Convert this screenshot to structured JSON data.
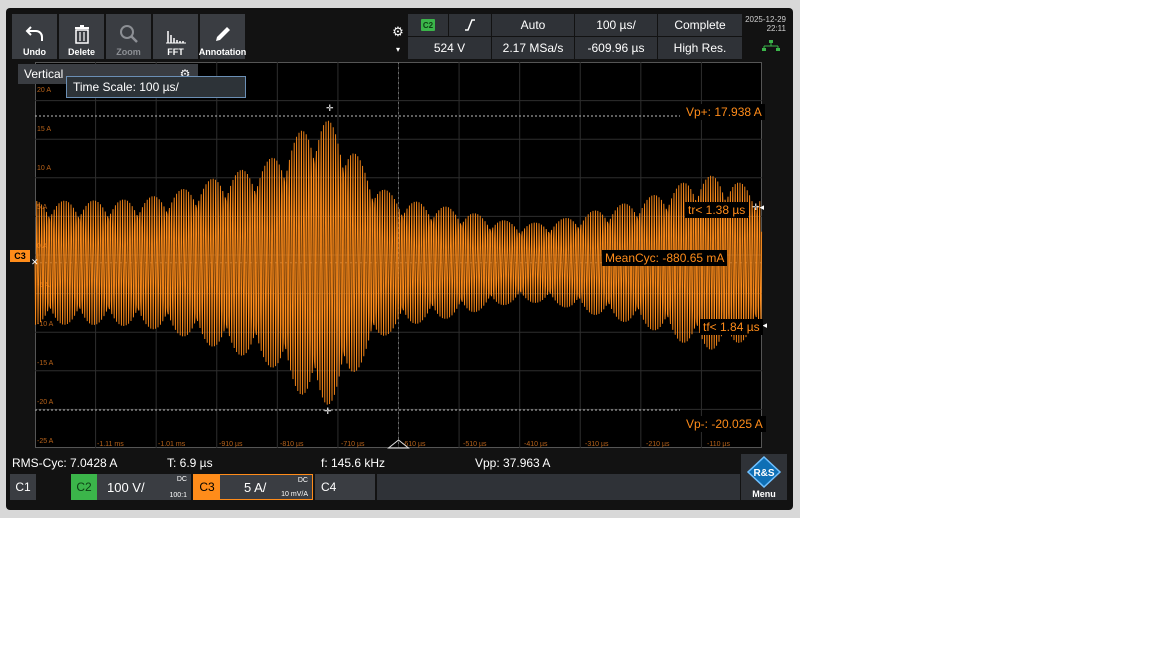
{
  "toolbar": {
    "undo_label": "Undo",
    "delete_label": "Delete",
    "zoom_label": "Zoom",
    "fft_label": "FFT",
    "annotation_label": "Annotation"
  },
  "status": {
    "trigger_source": "C2",
    "trigger_mode": "Auto",
    "timebase": "100 µs/",
    "acq_state": "Complete",
    "trigger_level": "524 V",
    "sample_rate": "2.17 MSa/s",
    "position": "-609.96 µs",
    "acq_mode": "High Res."
  },
  "datetime": {
    "date": "2025-12-29",
    "time": "22:11"
  },
  "vertical_label": "Vertical",
  "tooltip": "Time Scale: 100 µs/",
  "y_ticks": [
    "20 A",
    "15 A",
    "10 A",
    "5 A",
    "0 A",
    "-5 A",
    "-10 A",
    "-15 A",
    "-20 A",
    "-25 A"
  ],
  "x_ticks": [
    "-1.11 ms",
    "-1.01 ms",
    "-910 µs",
    "-810 µs",
    "-710 µs",
    "-610 µs",
    "-510 µs",
    "-410 µs",
    "-310 µs",
    "-210 µs",
    "-110 µs"
  ],
  "measurements": {
    "vp_plus": "Vp+: 17.938 A",
    "tr": "tr< 1.38 µs",
    "mean": "MeanCyc: -880.65 mA",
    "tf": "tf< 1.84 µs",
    "vp_minus": "Vp-: -20.025 A"
  },
  "ch3_marker": "C3",
  "results": {
    "rms": "RMS-Cyc: 7.0428 A",
    "period": "T: 6.9 µs",
    "freq": "f: 145.6 kHz",
    "vpp": "Vpp: 37.963 A"
  },
  "channels": {
    "c1": "C1",
    "c2": "C2",
    "c2_scale": "100 V/",
    "c2_coupling": "DC",
    "c2_probe": "100:1",
    "c3": "C3",
    "c3_scale": "5 A/",
    "c3_coupling": "DC",
    "c3_probe": "10 mV/A",
    "c4": "C4"
  },
  "menu_label": "Menu",
  "colors": {
    "trace": "#ff8c1a",
    "accent_green": "#3bb54a",
    "background": "#000000"
  }
}
